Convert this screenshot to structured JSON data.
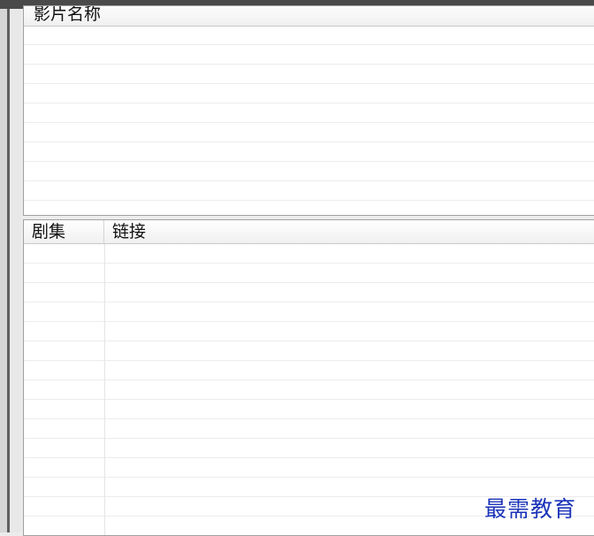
{
  "film_list": {
    "column_title": "影片名称",
    "rows": [
      "",
      "",
      "",
      "",
      "",
      "",
      "",
      "",
      ""
    ]
  },
  "episode_list": {
    "columns": [
      "剧集",
      "链接"
    ],
    "rows": [
      "",
      "",
      "",
      "",
      "",
      "",
      "",
      "",
      "",
      "",
      "",
      "",
      "",
      "",
      ""
    ]
  },
  "watermark": "最需教育",
  "colors": {
    "top_strip": "#4a4a4a",
    "watermark": "#1b34b8"
  }
}
